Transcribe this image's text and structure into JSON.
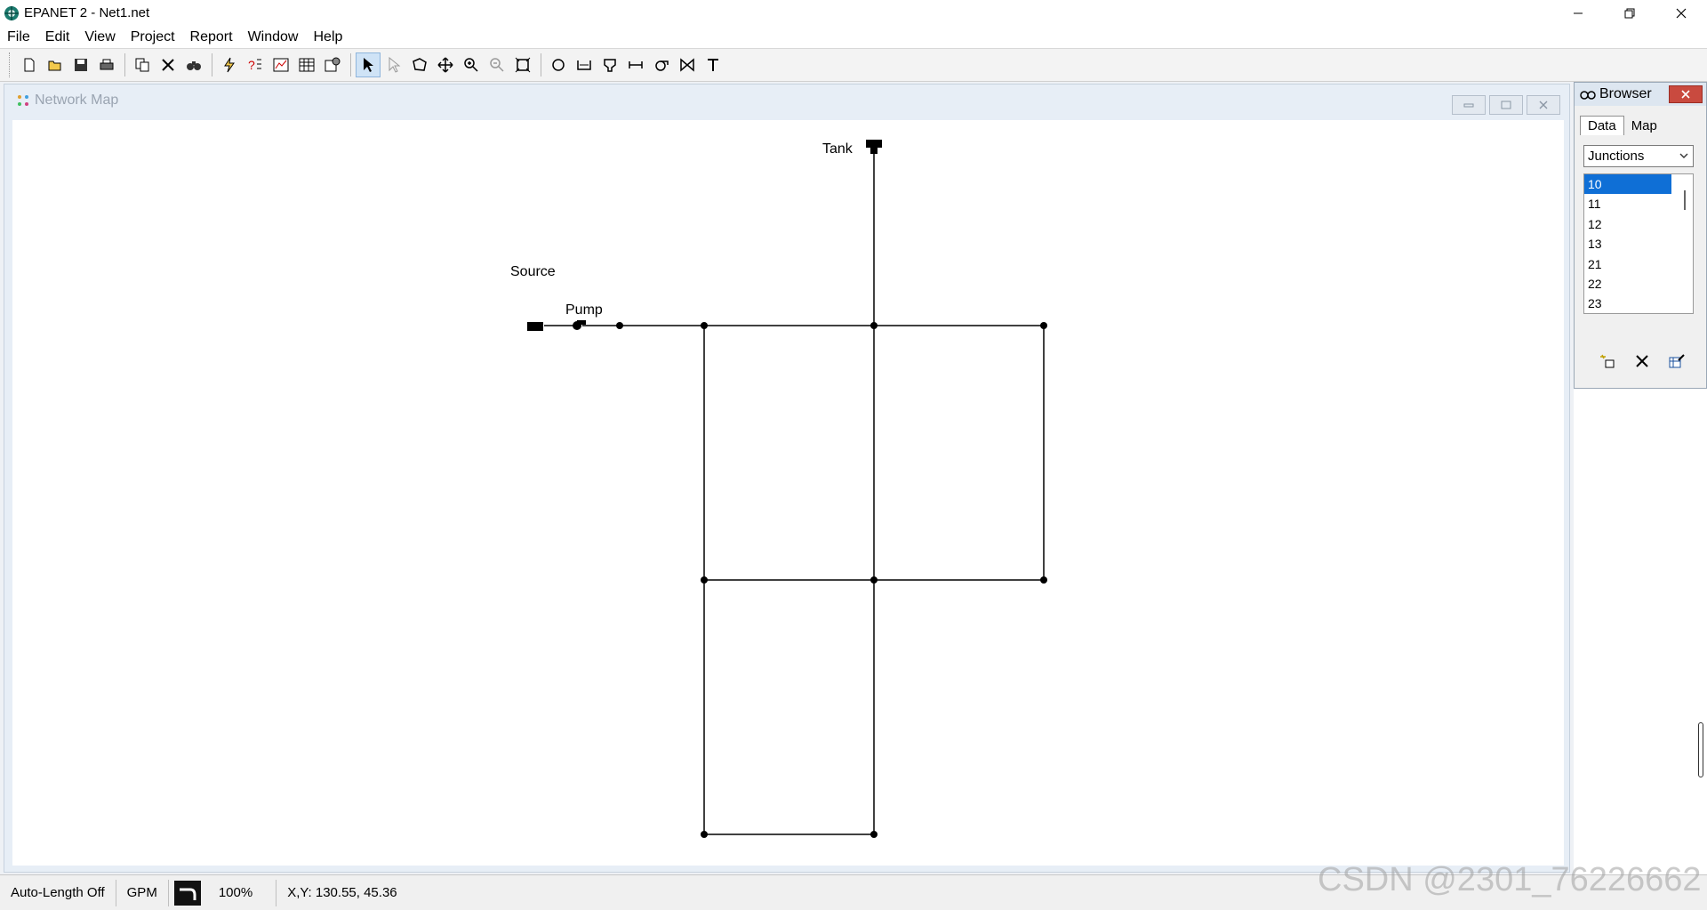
{
  "window": {
    "title": "EPANET 2 - Net1.net"
  },
  "menu": {
    "items": [
      "File",
      "Edit",
      "View",
      "Project",
      "Report",
      "Window",
      "Help"
    ]
  },
  "network_map": {
    "title": "Network Map",
    "labels": {
      "tank": "Tank",
      "source": "Source",
      "pump": "Pump"
    }
  },
  "browser": {
    "title": "Browser",
    "tabs": [
      "Data",
      "Map"
    ],
    "category": "Junctions",
    "items": [
      "10",
      "11",
      "12",
      "13",
      "21",
      "22",
      "23"
    ],
    "selected": "10"
  },
  "statusbar": {
    "auto_length": "Auto-Length Off",
    "flow_units": "GPM",
    "zoom": "100%",
    "coords": "X,Y: 130.55, 45.36"
  },
  "watermark": "CSDN @2301_76226662"
}
